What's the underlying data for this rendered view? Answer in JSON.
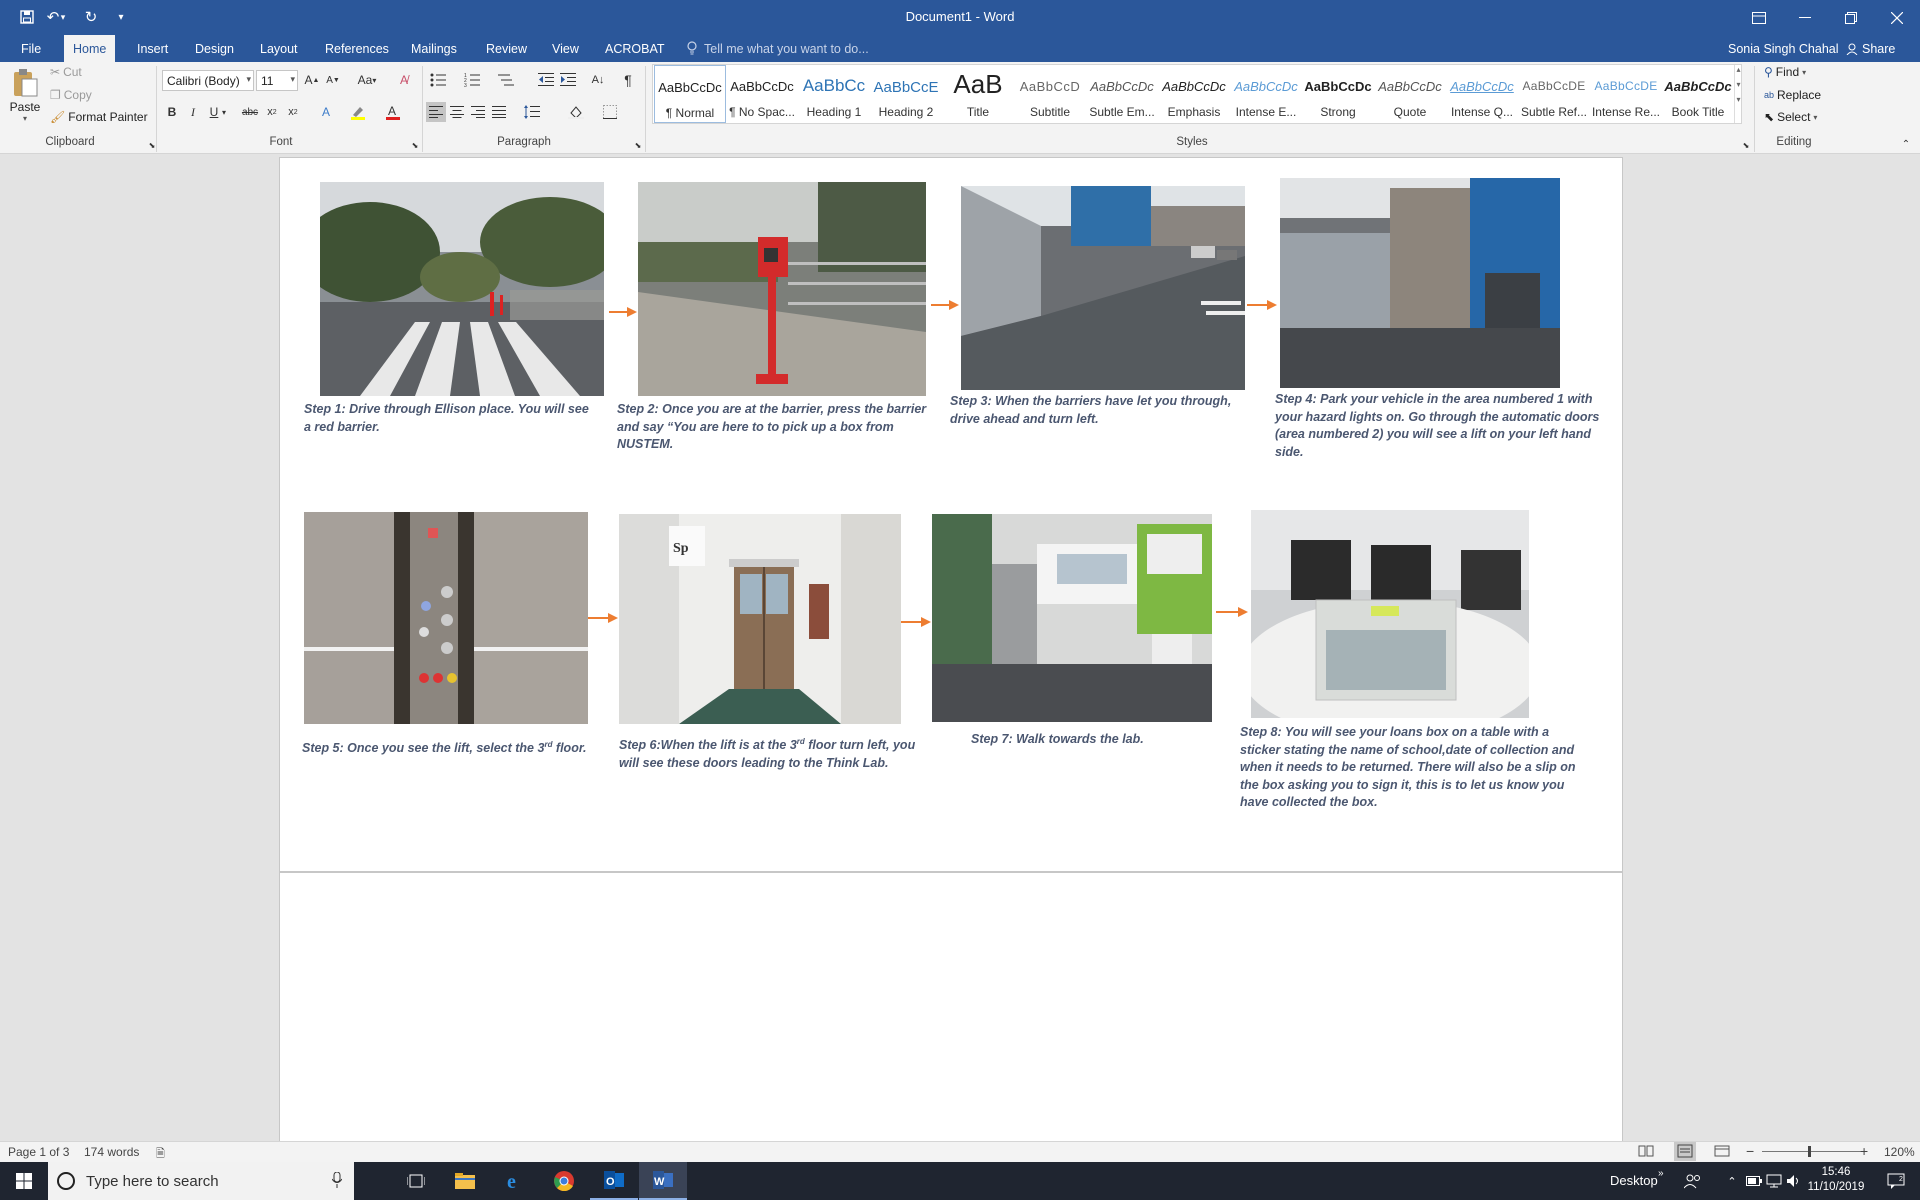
{
  "window": {
    "title": "Document1 - Word"
  },
  "tabs": [
    {
      "label": "File"
    },
    {
      "label": "Home"
    },
    {
      "label": "Insert"
    },
    {
      "label": "Design"
    },
    {
      "label": "Layout"
    },
    {
      "label": "References"
    },
    {
      "label": "Mailings"
    },
    {
      "label": "Review"
    },
    {
      "label": "View"
    },
    {
      "label": "ACROBAT"
    }
  ],
  "tellme": "Tell me what you want to do...",
  "user": "Sonia Singh Chahal",
  "share": "Share",
  "clipboard": {
    "paste": "Paste",
    "cut": "Cut",
    "copy": "Copy",
    "format_painter": "Format Painter",
    "label": "Clipboard"
  },
  "font": {
    "name": "Calibri (Body)",
    "size": "11",
    "case": "Aa",
    "label": "Font"
  },
  "paragraph": {
    "label": "Paragraph"
  },
  "styles": {
    "label": "Styles",
    "items": [
      {
        "preview": "AaBbCcDc",
        "name": "¶ Normal"
      },
      {
        "preview": "AaBbCcDc",
        "name": "¶ No Spac..."
      },
      {
        "preview": "AaBbCc",
        "name": "Heading 1"
      },
      {
        "preview": "AaBbCcE",
        "name": "Heading 2"
      },
      {
        "preview": "AaB",
        "name": "Title"
      },
      {
        "preview": "AaBbCcD",
        "name": "Subtitle"
      },
      {
        "preview": "AaBbCcDc",
        "name": "Subtle Em..."
      },
      {
        "preview": "AaBbCcDc",
        "name": "Emphasis"
      },
      {
        "preview": "AaBbCcDc",
        "name": "Intense E..."
      },
      {
        "preview": "AaBbCcDc",
        "name": "Strong"
      },
      {
        "preview": "AaBbCcDc",
        "name": "Quote"
      },
      {
        "preview": "AaBbCcDc",
        "name": "Intense Q..."
      },
      {
        "preview": "AaBbCcDE",
        "name": "Subtle Ref..."
      },
      {
        "preview": "AaBbCcDE",
        "name": "Intense Re..."
      },
      {
        "preview": "AaBbCcDc",
        "name": "Book Title"
      }
    ]
  },
  "editing": {
    "find": "Find",
    "replace": "Replace",
    "select": "Select",
    "label": "Editing"
  },
  "steps": [
    {
      "caption": "Step 1: Drive through Ellison place. You will see a red barrier."
    },
    {
      "caption": "Step 2: Once you are at the barrier, press the barrier and say “You are here to to pick up a box from NUSTEM."
    },
    {
      "caption": "Step 3: When the barriers have let you through, drive ahead and turn left."
    },
    {
      "caption": "Step 4: Park your vehicle in the area numbered 1 with your hazard lights on. Go through the automatic doors (area numbered 2) you will see a lift on your left hand side."
    },
    {
      "caption_pre": "Step 5: Once you see the lift, select the 3",
      "sup": "rd",
      "caption_post": " floor."
    },
    {
      "caption_pre": "Step 6:When the lift is at the 3",
      "sup": "rd",
      "caption_post": " floor turn left, you will see these doors leading to the Think Lab."
    },
    {
      "caption": "Step 7: Walk towards the lab."
    },
    {
      "caption": "Step 8: You will see your loans box on a table with a sticker stating the name of school,date of collection and when it needs to be returned. There will also be a slip on the box asking you to sign it, this is to let us know you have collected the box."
    }
  ],
  "status": {
    "page": "Page 1 of 3",
    "words": "174 words",
    "zoom": "120%"
  },
  "taskbar": {
    "search_placeholder": "Type here to search",
    "desktop": "Desktop",
    "time": "15:46",
    "date": "11/10/2019"
  },
  "colors": {
    "word_blue": "#2b579a",
    "caption": "#4b5770",
    "arrow": "#ed7d31"
  }
}
